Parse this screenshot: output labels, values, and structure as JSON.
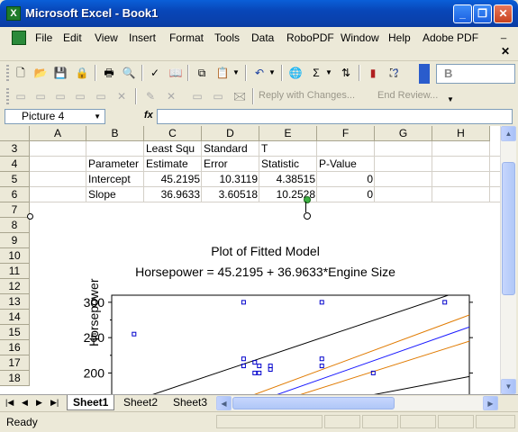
{
  "window": {
    "title": "Microsoft Excel - Book1",
    "controls": [
      "_",
      "❐",
      "✕"
    ]
  },
  "menu": {
    "items": [
      "File",
      "Edit",
      "View",
      "Insert",
      "Format",
      "Tools",
      "Data",
      "RoboPDF",
      "Window",
      "Help",
      "Adobe PDF"
    ],
    "doc_controls": [
      "_",
      "🗗",
      "✕"
    ]
  },
  "toolbar": {
    "font_label": "B",
    "reply_label": "Reply with Changes...",
    "end_review_label": "End Review..."
  },
  "formula_bar": {
    "name_box": "Picture 4",
    "fx": "fx",
    "formula": ""
  },
  "columns": [
    "A",
    "B",
    "C",
    "D",
    "E",
    "F",
    "G",
    "H"
  ],
  "rows": [
    "3",
    "4",
    "5",
    "6",
    "7",
    "8",
    "9",
    "10",
    "11",
    "12",
    "13",
    "14",
    "15",
    "16",
    "17",
    "18"
  ],
  "cells": {
    "c3": "Least Squ",
    "d3": "Standard",
    "e3": "T",
    "b4": "Parameter",
    "c4": "Estimate",
    "d4": "Error",
    "e4": "Statistic",
    "f4": "P-Value",
    "b5": "Intercept",
    "c5": "45.2195",
    "d5": "10.3119",
    "e5": "4.38515",
    "f5": "0",
    "b6": "Slope",
    "c6": "36.9633",
    "d6": "3.60518",
    "e6": "10.2528",
    "f6": "0"
  },
  "chart_data": {
    "type": "scatter",
    "title": "Plot of Fitted Model",
    "subtitle": "Horsepower = 45.2195 + 36.9633*Engine Size",
    "ylabel": "Horsepower",
    "yticks": [
      "300",
      "250",
      "200"
    ],
    "ylim": [
      170,
      310
    ],
    "x": [
      1.0,
      5.9,
      5.9,
      5.9,
      6.4,
      6.4,
      6.6,
      6.6,
      7.1,
      7.1,
      9.4,
      9.4,
      9.4,
      11.7,
      14.9
    ],
    "y": [
      255,
      300,
      220,
      210,
      215,
      200,
      210,
      200,
      205,
      210,
      300,
      220,
      210,
      200,
      300
    ],
    "xlim": [
      0,
      16
    ],
    "fitted_lines": [
      {
        "name": "prediction-upper",
        "color": "#000000",
        "x": [
          0,
          16
        ],
        "y": [
          150,
          320
        ]
      },
      {
        "name": "confidence-upper",
        "color": "#e07a00",
        "x": [
          6,
          16
        ],
        "y": [
          165,
          282
        ]
      },
      {
        "name": "fit",
        "color": "#1a1aff",
        "x": [
          7,
          16
        ],
        "y": [
          165,
          265
        ]
      },
      {
        "name": "confidence-lower",
        "color": "#e07a00",
        "x": [
          8,
          16
        ],
        "y": [
          165,
          245
        ]
      },
      {
        "name": "prediction-lower",
        "color": "#000000",
        "x": [
          11,
          16
        ],
        "y": [
          165,
          195
        ]
      }
    ],
    "point_color": "#0000cc"
  },
  "sheets": {
    "tabs": [
      "Sheet1",
      "Sheet2",
      "Sheet3"
    ],
    "active": "Sheet1"
  },
  "status": {
    "text": "Ready"
  }
}
